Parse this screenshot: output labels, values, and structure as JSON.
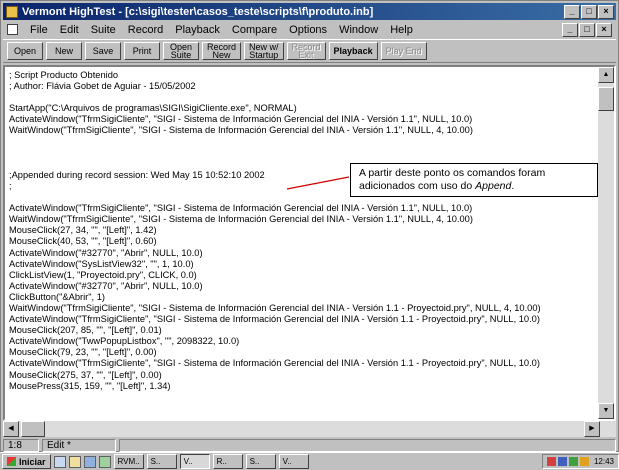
{
  "window": {
    "title": "Vermont HighTest - [c:\\sigi\\tester\\casos_teste\\scripts\\f\\produto.inb]"
  },
  "menu": [
    "File",
    "Edit",
    "Suite",
    "Record",
    "Playback",
    "Compare",
    "Options",
    "Window",
    "Help"
  ],
  "toolbar": [
    {
      "label": "Open",
      "enabled": true
    },
    {
      "label": "New",
      "enabled": true
    },
    {
      "label": "Save",
      "enabled": true
    },
    {
      "label": "Print",
      "enabled": true
    },
    {
      "label": "Open\nSuite",
      "enabled": true
    },
    {
      "label": "Record\nNew",
      "enabled": true
    },
    {
      "label": "New w/\nStartup",
      "enabled": true
    },
    {
      "label": "Record\nExit",
      "enabled": false
    },
    {
      "label": "Playback",
      "enabled": true
    },
    {
      "label": "Play End",
      "enabled": false
    }
  ],
  "script_lines": [
    "; Script Producto Obtenido",
    "; Author: Flávia Gobet de Aguiar - 15/05/2002",
    "",
    "StartApp(\"C:\\Arquivos de programas\\SIGI\\SigiCliente.exe\", NORMAL)",
    "ActivateWindow(\"TfrmSigiCliente\", \"SIGI - Sistema de Información Gerencial del INIA - Versión 1.1\", NULL, 10.0)",
    "WaitWindow(\"TfrmSigiCliente\", \"SIGI - Sistema de Información Gerencial del INIA - Versión 1.1\", NULL, 4, 10.00)",
    "",
    "",
    "",
    ";Appended during record session: Wed May 15 10:52:10 2002",
    ";",
    "",
    "ActivateWindow(\"TfrmSigiCliente\", \"SIGI - Sistema de Información Gerencial del INIA - Versión 1.1\", NULL, 10.0)",
    "WaitWindow(\"TfrmSigiCliente\", \"SIGI - Sistema de Información Gerencial del INIA - Versión 1.1\", NULL, 4, 10.00)",
    "MouseClick(27, 34, \"\", \"[Left]\", 1.42)",
    "MouseClick(40, 53, \"\", \"[Left]\", 0.60)",
    "ActivateWindow(\"#32770\", \"Abrir\", NULL, 10.0)",
    "ActivateWindow(\"SysListView32\", \"\", 1, 10.0)",
    "ClickListView(1, \"Proyectoid.pry\", CLICK, 0.0)",
    "ActivateWindow(\"#32770\", \"Abrir\", NULL, 10.0)",
    "ClickButton(\"&Abrir\", 1)",
    "WaitWindow(\"TfrmSigiCliente\", \"SIGI - Sistema de Información Gerencial del INIA - Versión 1.1 - Proyectoid.pry\", NULL, 4, 10.00)",
    "ActivateWindow(\"TfrmSigiCliente\", \"SIGI - Sistema de Información Gerencial del INIA - Versión 1.1 - Proyectoid.pry\", NULL, 10.0)",
    "MouseClick(207, 85, \"\", \"[Left]\", 0.01)",
    "ActivateWindow(\"TwwPopupListbox\", \"\", 2098322, 10.0)",
    "MouseClick(79, 23, \"\", \"[Left]\", 0.00)",
    "ActivateWindow(\"TfrmSigiCliente\", \"SIGI - Sistema de Información Gerencial del INIA - Versión 1.1 - Proyectoid.pry\", NULL, 10.0)",
    "MouseClick(275, 37, \"\", \"[Left]\", 0.00)",
    "MousePress(315, 159, \"\", \"[Left]\", 1.34)"
  ],
  "callout": {
    "line1": "A partir deste ponto os comandos foram",
    "line2_prefix": "adicionados com uso do ",
    "line2_emph": "Append",
    "line2_suffix": "."
  },
  "status": {
    "position": "1:8",
    "mode": "Edit *"
  },
  "taskbar": {
    "start_label": "Iniciar",
    "tasks": [
      "RVM..",
      "S..",
      "V..",
      "R..",
      "S..",
      "V.."
    ],
    "clock": "12:43"
  }
}
